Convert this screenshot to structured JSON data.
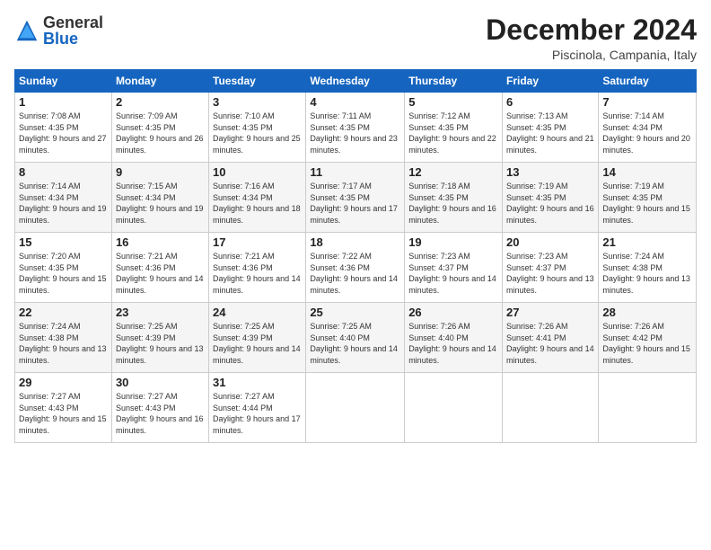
{
  "logo": {
    "general": "General",
    "blue": "Blue"
  },
  "header": {
    "month": "December 2024",
    "location": "Piscinola, Campania, Italy"
  },
  "days_of_week": [
    "Sunday",
    "Monday",
    "Tuesday",
    "Wednesday",
    "Thursday",
    "Friday",
    "Saturday"
  ],
  "weeks": [
    [
      {
        "day": 1,
        "sunrise": "7:08 AM",
        "sunset": "4:35 PM",
        "daylight": "9 hours and 27 minutes."
      },
      {
        "day": 2,
        "sunrise": "7:09 AM",
        "sunset": "4:35 PM",
        "daylight": "9 hours and 26 minutes."
      },
      {
        "day": 3,
        "sunrise": "7:10 AM",
        "sunset": "4:35 PM",
        "daylight": "9 hours and 25 minutes."
      },
      {
        "day": 4,
        "sunrise": "7:11 AM",
        "sunset": "4:35 PM",
        "daylight": "9 hours and 23 minutes."
      },
      {
        "day": 5,
        "sunrise": "7:12 AM",
        "sunset": "4:35 PM",
        "daylight": "9 hours and 22 minutes."
      },
      {
        "day": 6,
        "sunrise": "7:13 AM",
        "sunset": "4:35 PM",
        "daylight": "9 hours and 21 minutes."
      },
      {
        "day": 7,
        "sunrise": "7:14 AM",
        "sunset": "4:34 PM",
        "daylight": "9 hours and 20 minutes."
      }
    ],
    [
      {
        "day": 8,
        "sunrise": "7:14 AM",
        "sunset": "4:34 PM",
        "daylight": "9 hours and 19 minutes."
      },
      {
        "day": 9,
        "sunrise": "7:15 AM",
        "sunset": "4:34 PM",
        "daylight": "9 hours and 19 minutes."
      },
      {
        "day": 10,
        "sunrise": "7:16 AM",
        "sunset": "4:34 PM",
        "daylight": "9 hours and 18 minutes."
      },
      {
        "day": 11,
        "sunrise": "7:17 AM",
        "sunset": "4:35 PM",
        "daylight": "9 hours and 17 minutes."
      },
      {
        "day": 12,
        "sunrise": "7:18 AM",
        "sunset": "4:35 PM",
        "daylight": "9 hours and 16 minutes."
      },
      {
        "day": 13,
        "sunrise": "7:19 AM",
        "sunset": "4:35 PM",
        "daylight": "9 hours and 16 minutes."
      },
      {
        "day": 14,
        "sunrise": "7:19 AM",
        "sunset": "4:35 PM",
        "daylight": "9 hours and 15 minutes."
      }
    ],
    [
      {
        "day": 15,
        "sunrise": "7:20 AM",
        "sunset": "4:35 PM",
        "daylight": "9 hours and 15 minutes."
      },
      {
        "day": 16,
        "sunrise": "7:21 AM",
        "sunset": "4:36 PM",
        "daylight": "9 hours and 14 minutes."
      },
      {
        "day": 17,
        "sunrise": "7:21 AM",
        "sunset": "4:36 PM",
        "daylight": "9 hours and 14 minutes."
      },
      {
        "day": 18,
        "sunrise": "7:22 AM",
        "sunset": "4:36 PM",
        "daylight": "9 hours and 14 minutes."
      },
      {
        "day": 19,
        "sunrise": "7:23 AM",
        "sunset": "4:37 PM",
        "daylight": "9 hours and 14 minutes."
      },
      {
        "day": 20,
        "sunrise": "7:23 AM",
        "sunset": "4:37 PM",
        "daylight": "9 hours and 13 minutes."
      },
      {
        "day": 21,
        "sunrise": "7:24 AM",
        "sunset": "4:38 PM",
        "daylight": "9 hours and 13 minutes."
      }
    ],
    [
      {
        "day": 22,
        "sunrise": "7:24 AM",
        "sunset": "4:38 PM",
        "daylight": "9 hours and 13 minutes."
      },
      {
        "day": 23,
        "sunrise": "7:25 AM",
        "sunset": "4:39 PM",
        "daylight": "9 hours and 13 minutes."
      },
      {
        "day": 24,
        "sunrise": "7:25 AM",
        "sunset": "4:39 PM",
        "daylight": "9 hours and 14 minutes."
      },
      {
        "day": 25,
        "sunrise": "7:25 AM",
        "sunset": "4:40 PM",
        "daylight": "9 hours and 14 minutes."
      },
      {
        "day": 26,
        "sunrise": "7:26 AM",
        "sunset": "4:40 PM",
        "daylight": "9 hours and 14 minutes."
      },
      {
        "day": 27,
        "sunrise": "7:26 AM",
        "sunset": "4:41 PM",
        "daylight": "9 hours and 14 minutes."
      },
      {
        "day": 28,
        "sunrise": "7:26 AM",
        "sunset": "4:42 PM",
        "daylight": "9 hours and 15 minutes."
      }
    ],
    [
      {
        "day": 29,
        "sunrise": "7:27 AM",
        "sunset": "4:43 PM",
        "daylight": "9 hours and 15 minutes."
      },
      {
        "day": 30,
        "sunrise": "7:27 AM",
        "sunset": "4:43 PM",
        "daylight": "9 hours and 16 minutes."
      },
      {
        "day": 31,
        "sunrise": "7:27 AM",
        "sunset": "4:44 PM",
        "daylight": "9 hours and 17 minutes."
      },
      null,
      null,
      null,
      null
    ]
  ]
}
